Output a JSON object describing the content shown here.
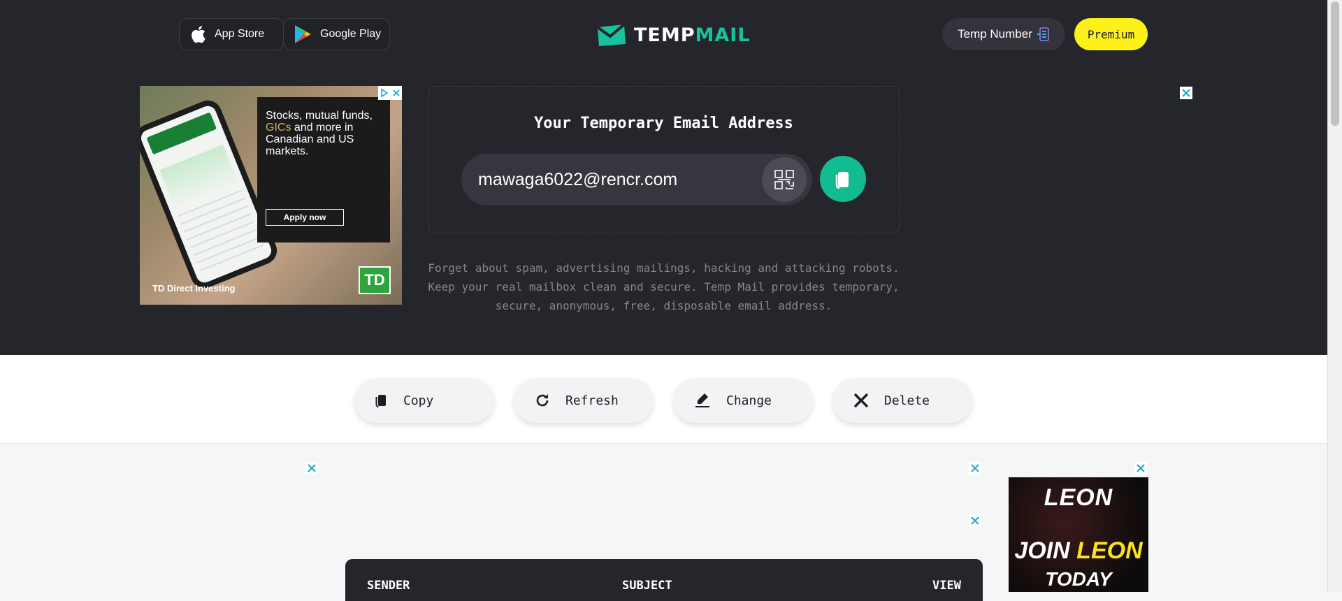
{
  "header": {
    "app_store_label": "App Store",
    "google_play_label": "Google Play",
    "logo": {
      "part1": "TEMP",
      "part2": "MAIL"
    },
    "temp_number_label": "Temp Number",
    "premium_label": "Premium"
  },
  "left_ad": {
    "headline_part1": "Stocks, mutual funds, ",
    "headline_accent": "GICs",
    "headline_part2": " and more in Canadian and US markets.",
    "cta": "Apply now",
    "brand_label": "TD Direct Investing",
    "brand_logo": "TD"
  },
  "email": {
    "title": "Your Temporary Email Address",
    "address": "mawaga6022@rencr.com"
  },
  "description": "Forget about spam, advertising mailings, hacking and attacking robots. Keep your real mailbox clean and secure. Temp Mail provides temporary, secure, anonymous, free, disposable email address.",
  "actions": {
    "copy": "Copy",
    "refresh": "Refresh",
    "change": "Change",
    "delete": "Delete"
  },
  "leon_ad": {
    "logo": "LEON",
    "join": "JOIN",
    "join_accent": "LEON",
    "today": "TODAY"
  },
  "inbox": {
    "columns": [
      "SENDER",
      "SUBJECT",
      "VIEW"
    ]
  },
  "colors": {
    "hero_bg": "#25252c",
    "accent_green": "#13bb91",
    "premium_yellow": "#fdf11a"
  },
  "icons": [
    "apple-icon",
    "google-play-icon",
    "envelope-logo-icon",
    "temp-number-icon",
    "qr-code-icon",
    "copy-icon",
    "refresh-icon",
    "change-icon",
    "delete-icon",
    "close-icon",
    "ad-choices-icon"
  ]
}
